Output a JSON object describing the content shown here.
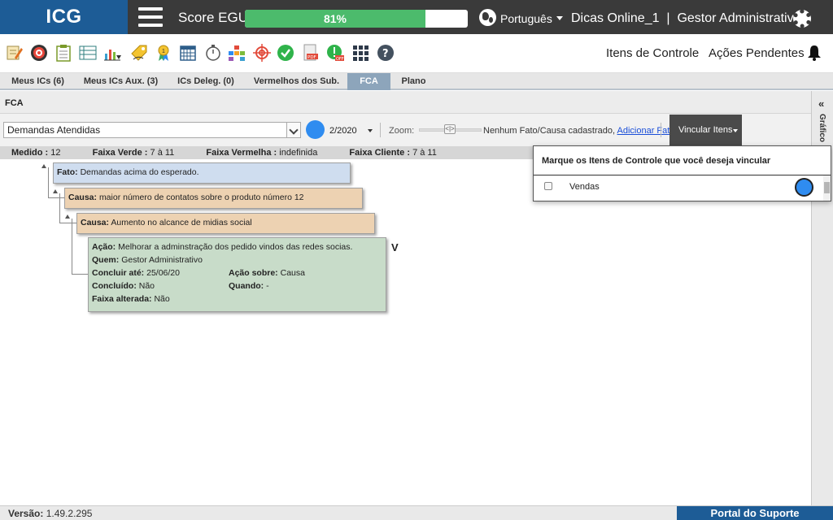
{
  "header": {
    "logo": "ICG",
    "score_label": "Score EGU:",
    "score_value": "81%",
    "score_percent": 81,
    "language": "Português",
    "user": "Dicas Online_1  |  Gestor Administrativo"
  },
  "toolbar": {
    "icons": [
      "edit-icon",
      "target-icon",
      "clipboard-icon",
      "list-icon",
      "chart-icon",
      "tag-icon",
      "ribbon-icon",
      "calendar-icon",
      "stopwatch-icon",
      "org-chart-icon",
      "crosshair-icon",
      "check-icon",
      "pdf-icon",
      "alert-off-icon",
      "apps-grid-icon",
      "help-icon"
    ],
    "itens_controle": "Itens de Controle",
    "acoes_pendentes": "Ações Pendentes"
  },
  "tabs": [
    {
      "label": "Meus ICs (6)"
    },
    {
      "label": "Meus ICs Aux. (3)"
    },
    {
      "label": "ICs Deleg. (0)"
    },
    {
      "label": "Vermelhos dos Sub."
    },
    {
      "label": "FCA",
      "active": true
    },
    {
      "label": "Plano"
    }
  ],
  "panel": {
    "title": "FCA",
    "rail_text": "Gráfico"
  },
  "filter": {
    "select_value": "Demandas Atendidas",
    "period": "2/2020",
    "zoom_label": "Zoom:",
    "zoom_thumb": "<|>",
    "no_fact": "Nenhum Fato/Causa cadastrado,",
    "add_fact": "Adicionar Fato",
    "vincular": "Vincular Itens"
  },
  "summary": {
    "medido_label": "Medido :",
    "medido": "12",
    "verde_label": "Faixa Verde :",
    "verde": "7 à 11",
    "vermelha_label": "Faixa Vermelha :",
    "vermelha": "indefinida",
    "cliente_label": "Faixa Cliente :",
    "cliente": "7 à 11"
  },
  "tree": {
    "fato": {
      "label": "Fato:",
      "text": "Demandas acima do esperado."
    },
    "causa1": {
      "label": "Causa:",
      "text": "maior número de contatos sobre o produto número 12"
    },
    "causa2": {
      "label": "Causa:",
      "text": "Aumento no alcance de midias social"
    },
    "acao": {
      "acao_label": "Ação:",
      "acao": "Melhorar a adminstração dos pedido vindos das redes socias.",
      "quem_label": "Quem:",
      "quem": "Gestor Administrativo",
      "concluir_label": "Concluir até:",
      "concluir": "25/06/20",
      "sobre_label": "Ação sobre:",
      "sobre": "Causa",
      "concluido_label": "Concluído:",
      "concluido": "Não",
      "quando_label": "Quando:",
      "quando": "-",
      "faixa_label": "Faixa alterada:",
      "faixa": "Não"
    },
    "mark": "V"
  },
  "popup": {
    "title": "Marque os Itens de Controle que você deseja vincular",
    "item": "Vendas"
  },
  "footer": {
    "version_label": "Versão:",
    "version": "1.49.2.295",
    "support": "Portal do Suporte"
  },
  "colors": {
    "brand": "#1d5c96",
    "topbar": "#3a3a3a",
    "score": "#4cbb6c",
    "dot": "#2f8cf0",
    "fato": "#cfddef",
    "causa": "#edd2b2",
    "acao": "#c8dcc9"
  }
}
